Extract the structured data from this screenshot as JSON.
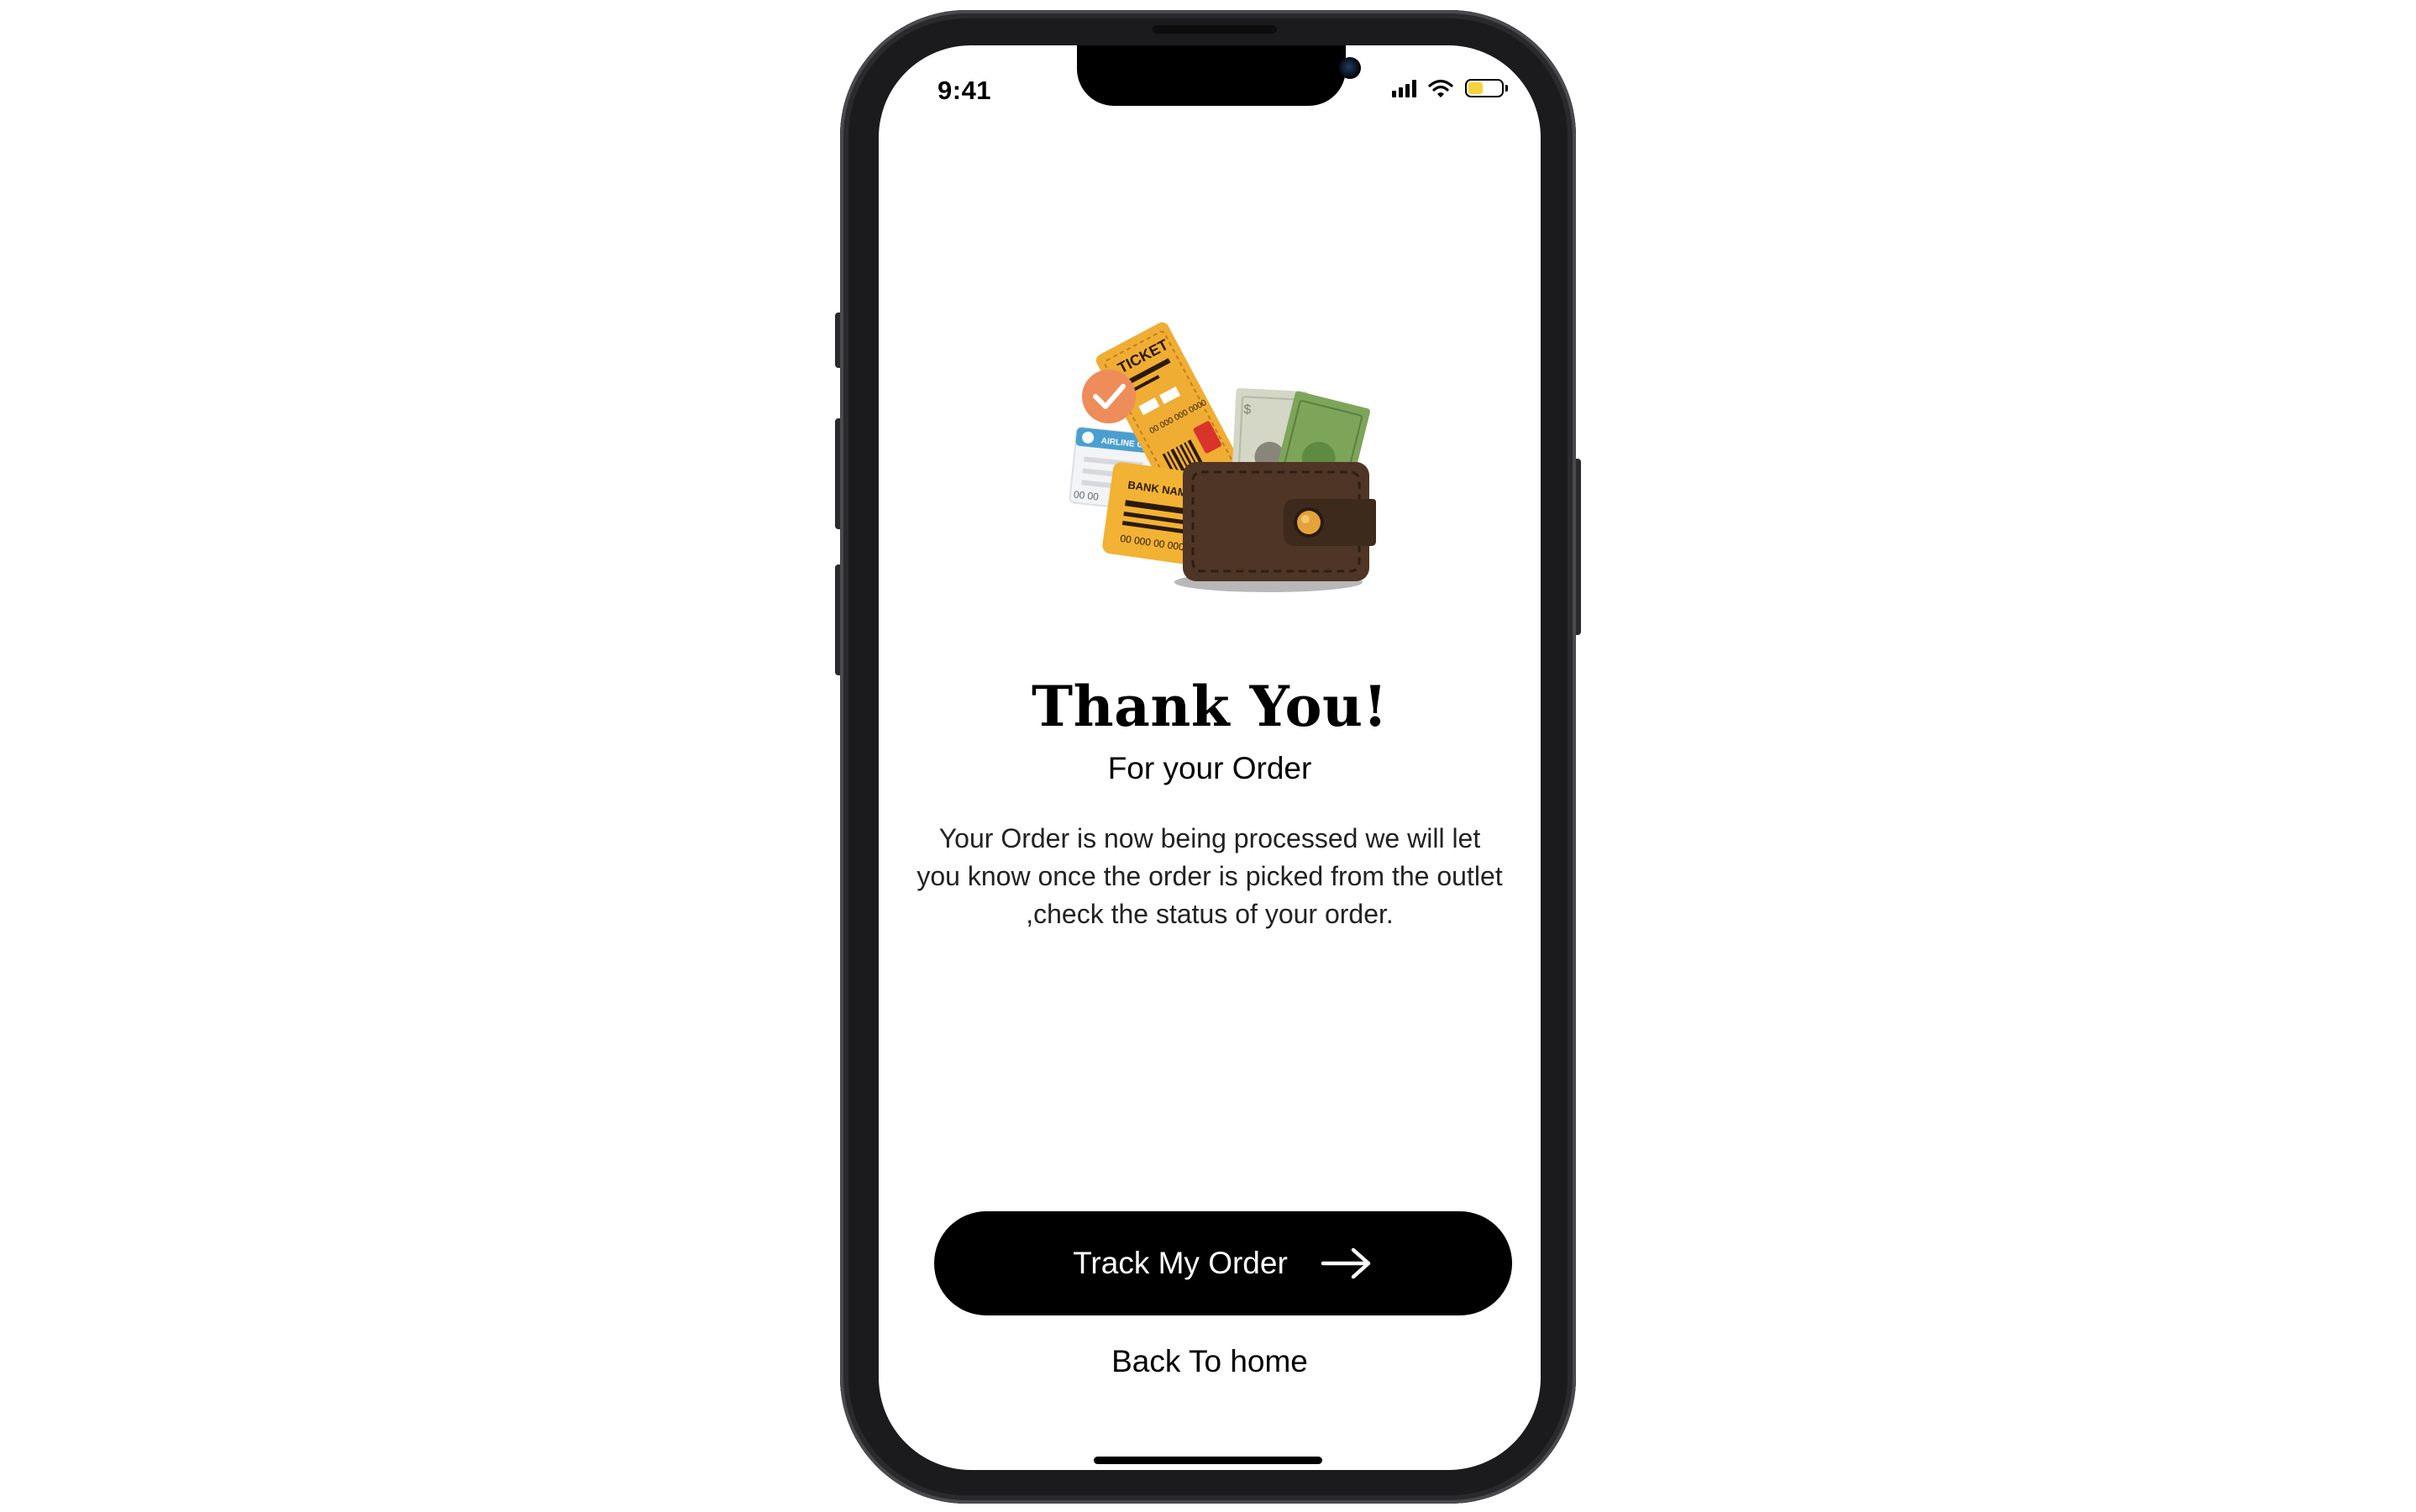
{
  "status_bar": {
    "time": "9:41",
    "battery_level": 0.45,
    "battery_color": "#f5d33b",
    "icons": [
      "signal-icon",
      "wifi-icon",
      "battery-icon"
    ]
  },
  "illustration": {
    "name": "wallet-with-cards-and-cash",
    "ticket_text": "TICKET",
    "ticket_number": "00 000 000 0000",
    "airline_text": "AIRLINE CARDS",
    "bank_card_name": "BANK NAME",
    "bank_card_number": "00 000 00 0000",
    "bank_card_stub": "00 00",
    "colors": {
      "check": "#ee8c5a",
      "ticket": "#efad34",
      "bank_card": "#f2b233",
      "wallet": "#4e3526",
      "cash_green": "#7da55a",
      "cash_light": "#d4d6c6",
      "airline_blue": "#4a9fd0"
    }
  },
  "content": {
    "title": "Thank You!",
    "subtitle": "For your Order",
    "message": "Your Order is now being processed we will let you know once the order is picked from the outlet ,check the status of your order."
  },
  "actions": {
    "track_label": "Track My Order",
    "track_icon": "arrow-right-icon",
    "home_label": "Back To home"
  },
  "colors": {
    "primary_button": "#000000",
    "primary_button_text": "#ffffff",
    "background": "#ffffff"
  }
}
